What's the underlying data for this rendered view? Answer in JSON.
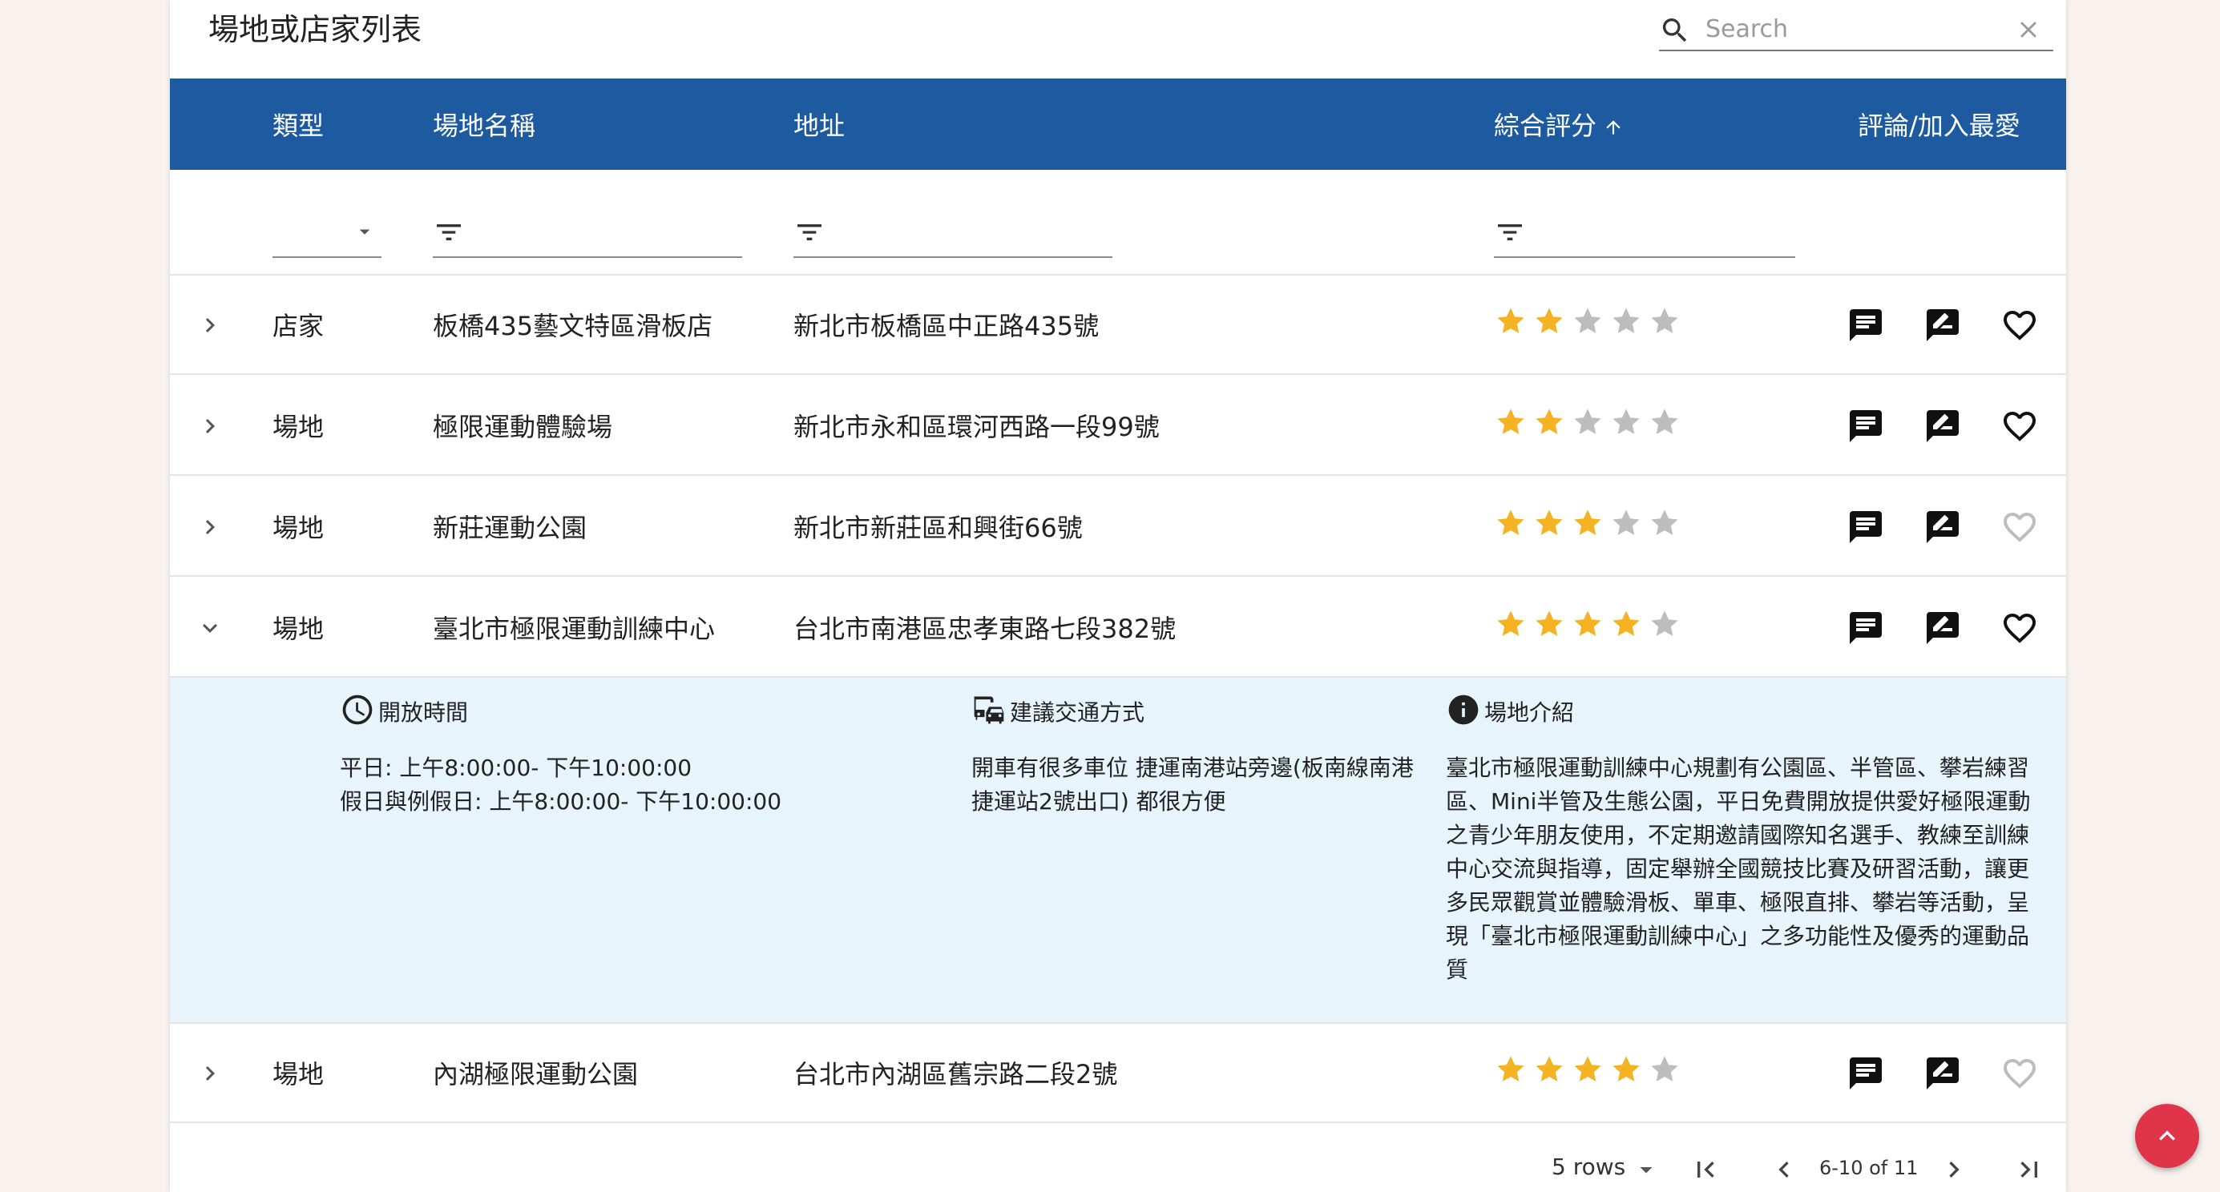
{
  "page": {
    "title": "場地或店家列表"
  },
  "search": {
    "placeholder": "Search",
    "value": ""
  },
  "columns": {
    "type": "類型",
    "name": "場地名稱",
    "address": "地址",
    "rating": "綜合評分",
    "actions": "評論/加入最愛"
  },
  "rows": [
    {
      "type": "店家",
      "name": "板橋435藝文特區滑板店",
      "address": "新北市板橋區中正路435號",
      "rating": 2,
      "favorite": "filled",
      "expanded": false
    },
    {
      "type": "場地",
      "name": "極限運動體驗場",
      "address": "新北市永和區環河西路一段99號",
      "rating": 2,
      "favorite": "filled",
      "expanded": false
    },
    {
      "type": "場地",
      "name": "新莊運動公園",
      "address": "新北市新莊區和興街66號",
      "rating": 3,
      "favorite": "light",
      "expanded": false
    },
    {
      "type": "場地",
      "name": "臺北市極限運動訓練中心",
      "address": "台北市南港區忠孝東路七段382號",
      "rating": 4,
      "favorite": "filled",
      "expanded": true
    },
    {
      "type": "場地",
      "name": "內湖極限運動公園",
      "address": "台北市內湖區舊宗路二段2號",
      "rating": 4,
      "favorite": "light",
      "expanded": false
    }
  ],
  "detail": {
    "hours_title": "開放時間",
    "weekday": "平日: 上午8:00:00- 下午10:00:00",
    "holiday": "假日與例假日: 上午8:00:00- 下午10:00:00",
    "transport_title": "建議交通方式",
    "transport_lines": [
      "開車有很多車位 捷運南港站旁邊(板南線南港",
      "捷運站2號出口) 都很方便"
    ],
    "intro_title": "場地介紹",
    "intro_lines": [
      "臺北市極限運動訓練中心規劃有公園區、半管區、攀岩練習",
      "區、Mini半管及生態公園，平日免費開放提供愛好極限運動",
      "之青少年朋友使用，不定期邀請國際知名選手、教練至訓練",
      "中心交流與指導，固定舉辦全國競技比賽及研習活動，讓更",
      "多民眾觀賞並體驗滑板、單車、極限直排、攀岩等活動，呈",
      "現「臺北市極限運動訓練中心」之多功能性及優秀的運動品",
      "質"
    ]
  },
  "pagination": {
    "rows_label": "5 rows",
    "range": "6-10 of 11"
  },
  "colors": {
    "header": "#1e5aa0",
    "star": "#f5b324",
    "star_empty": "#bdbdbd",
    "detail_bg": "#e7f4fc",
    "fab": "#e0344a"
  }
}
